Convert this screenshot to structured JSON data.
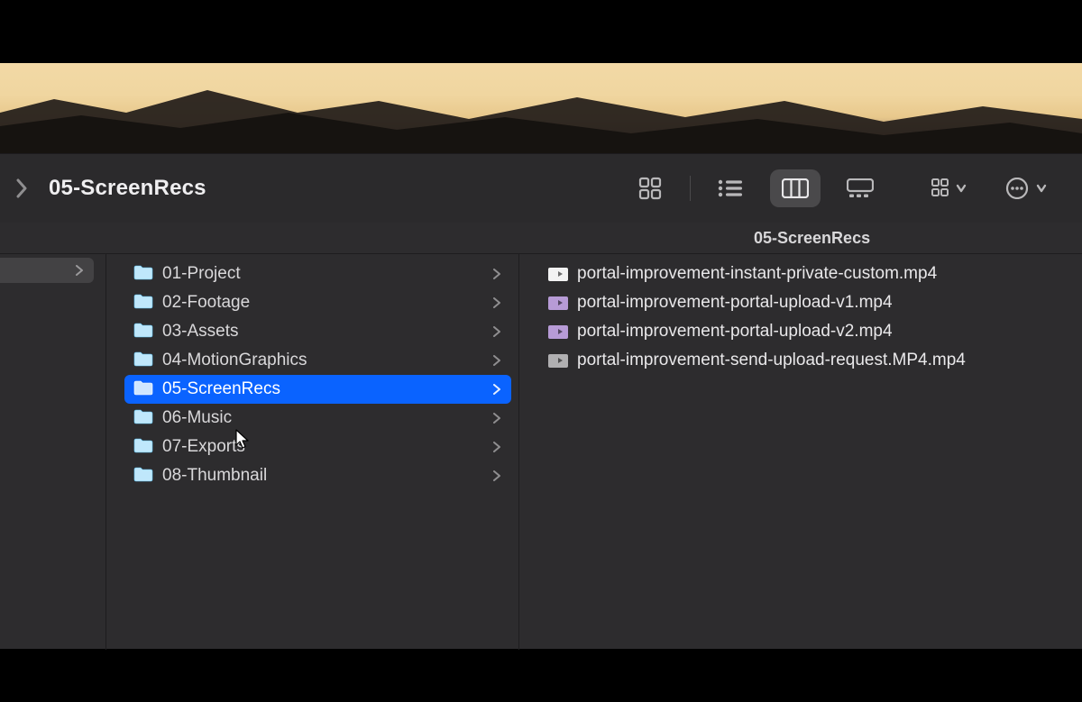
{
  "title": "05-ScreenRecs",
  "subheader": "05-ScreenRecs",
  "colors": {
    "folder": "#5fc0ef",
    "selection": "#0a63ff",
    "bg": "#2d2c2e"
  },
  "viewModes": {
    "icon": "icon-view",
    "list": "list-view",
    "column": "column-view",
    "gallery": "gallery-view",
    "active": "column"
  },
  "column1": [
    {
      "name": "01-Project",
      "selected": false,
      "hasChildren": true
    },
    {
      "name": "02-Footage",
      "selected": false,
      "hasChildren": true
    },
    {
      "name": "03-Assets",
      "selected": false,
      "hasChildren": true
    },
    {
      "name": "04-MotionGraphics",
      "selected": false,
      "hasChildren": true
    },
    {
      "name": "05-ScreenRecs",
      "selected": true,
      "hasChildren": true
    },
    {
      "name": "06-Music",
      "selected": false,
      "hasChildren": true
    },
    {
      "name": "07-Exports",
      "selected": false,
      "hasChildren": true
    },
    {
      "name": "08-Thumbnail",
      "selected": false,
      "hasChildren": true
    }
  ],
  "column2": [
    {
      "name": "portal-improvement-instant-private-custom.mp4",
      "icon": "white"
    },
    {
      "name": "portal-improvement-portal-upload-v1.mp4",
      "icon": "purple"
    },
    {
      "name": "portal-improvement-portal-upload-v2.mp4",
      "icon": "purple"
    },
    {
      "name": "portal-improvement-send-upload-request.MP4.mp4",
      "icon": "gray"
    }
  ]
}
